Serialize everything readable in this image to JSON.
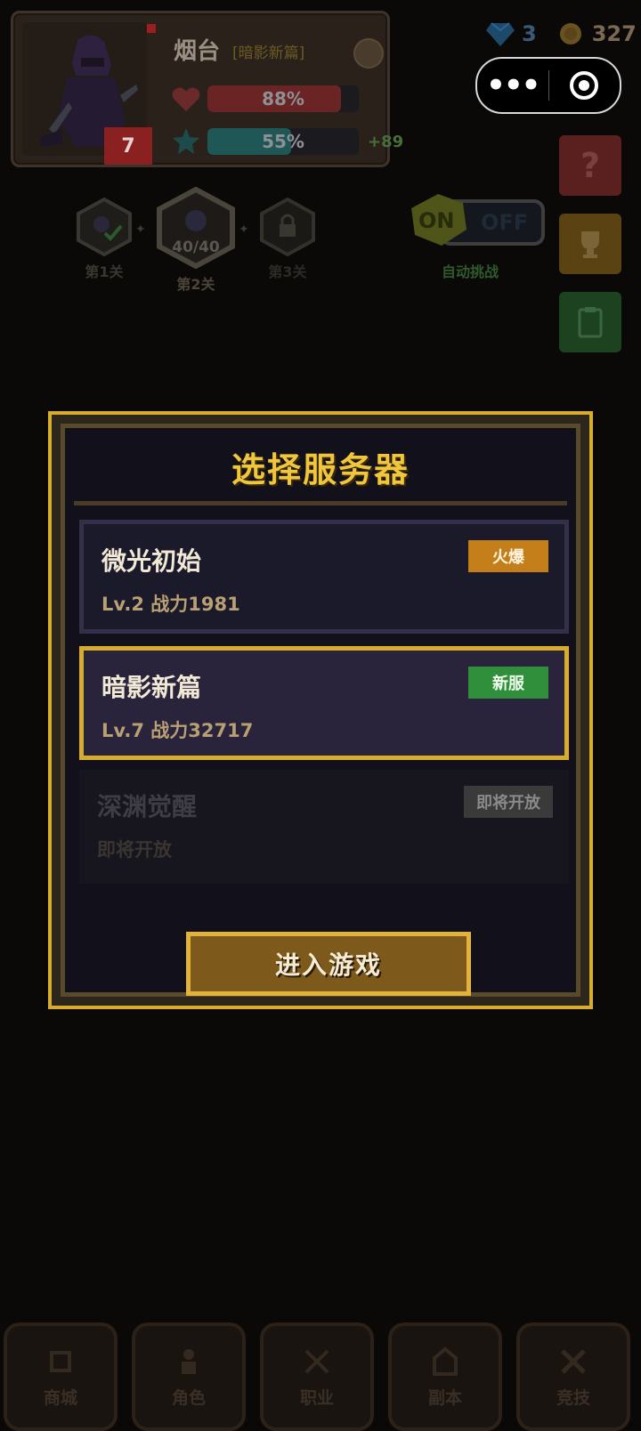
{
  "player": {
    "name": "烟台",
    "server_tag": "[暗影新篇]",
    "level": "7",
    "hp_text": "88%",
    "hp_fraction": 0.88,
    "xp_text": "55%",
    "xp_fraction": 0.55,
    "xp_gain": "+89"
  },
  "resources": {
    "gems": "3",
    "coins": "327"
  },
  "capsule": {
    "more_label": "•••"
  },
  "stages": [
    {
      "label": "第1关"
    },
    {
      "label": "第2关",
      "progress": "40/40"
    },
    {
      "label": "第3关"
    }
  ],
  "auto_challenge": {
    "on_label": "ON",
    "off_label": "OFF",
    "caption": "自动挑战"
  },
  "modal": {
    "title": "选择服务器",
    "servers": [
      {
        "name": "微光初始",
        "detail": "Lv.2  战力1981",
        "badge": "火爆",
        "badge_color": "#c47f1a"
      },
      {
        "name": "暗影新篇",
        "detail": "Lv.7  战力32717",
        "badge": "新服",
        "badge_color": "#2f8f3a"
      },
      {
        "name": "深渊觉醒",
        "detail": "即将开放",
        "badge": "即将开放",
        "badge_color": "#3a3a3a"
      }
    ],
    "enter_label": "进入游戏"
  },
  "side_buttons": [
    {
      "icon": "help-icon",
      "color": "#5a2020"
    },
    {
      "icon": "trophy-icon",
      "color": "#5a4213"
    },
    {
      "icon": "clipboard-icon",
      "color": "#1d4220"
    }
  ],
  "bottom_nav": [
    {
      "label": "商城",
      "icon": "shop-icon"
    },
    {
      "label": "角色",
      "icon": "character-icon"
    },
    {
      "label": "职业",
      "icon": "class-icon"
    },
    {
      "label": "副本",
      "icon": "dungeon-icon"
    },
    {
      "label": "竞技",
      "icon": "arena-icon"
    }
  ]
}
